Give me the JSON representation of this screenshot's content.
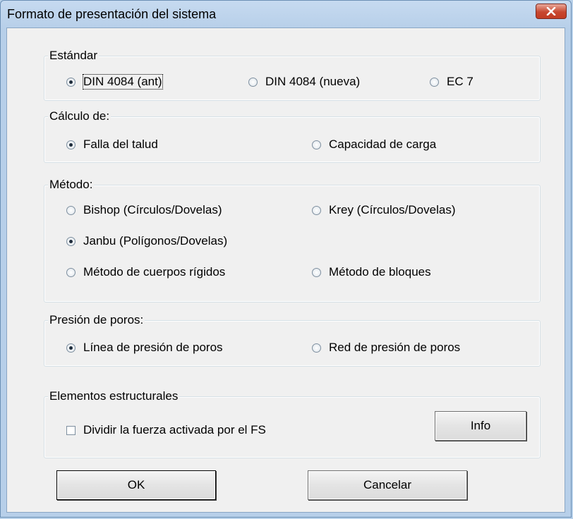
{
  "window": {
    "title": "Formato de presentación del sistema"
  },
  "groups": {
    "estandar": {
      "legend": "Estándar",
      "options": [
        {
          "label": "DIN 4084 (ant)",
          "checked": true
        },
        {
          "label": "DIN 4084 (nueva)",
          "checked": false
        },
        {
          "label": "EC 7",
          "checked": false
        }
      ]
    },
    "calculo": {
      "legend": "Cálculo de:",
      "options": [
        {
          "label": "Falla del talud",
          "checked": true
        },
        {
          "label": "Capacidad de carga",
          "checked": false
        }
      ]
    },
    "metodo": {
      "legend": "Método:",
      "options": [
        {
          "label": "Bishop (Círculos/Dovelas)",
          "checked": false
        },
        {
          "label": "Krey (Círculos/Dovelas)",
          "checked": false
        },
        {
          "label": "Janbu (Polígonos/Dovelas)",
          "checked": true
        },
        {
          "label": "Método de cuerpos rígidos",
          "checked": false
        },
        {
          "label": "Método de bloques",
          "checked": false
        }
      ]
    },
    "presion": {
      "legend": "Presión de poros:",
      "options": [
        {
          "label": "Línea de presión de poros",
          "checked": true
        },
        {
          "label": "Red de presión de poros",
          "checked": false
        }
      ]
    },
    "elementos": {
      "legend": "Elementos estructurales",
      "checkbox_label": "Dividir la fuerza activada por el FS",
      "checkbox_checked": false,
      "info_button": "Info"
    }
  },
  "buttons": {
    "ok": "OK",
    "cancel": "Cancelar"
  }
}
